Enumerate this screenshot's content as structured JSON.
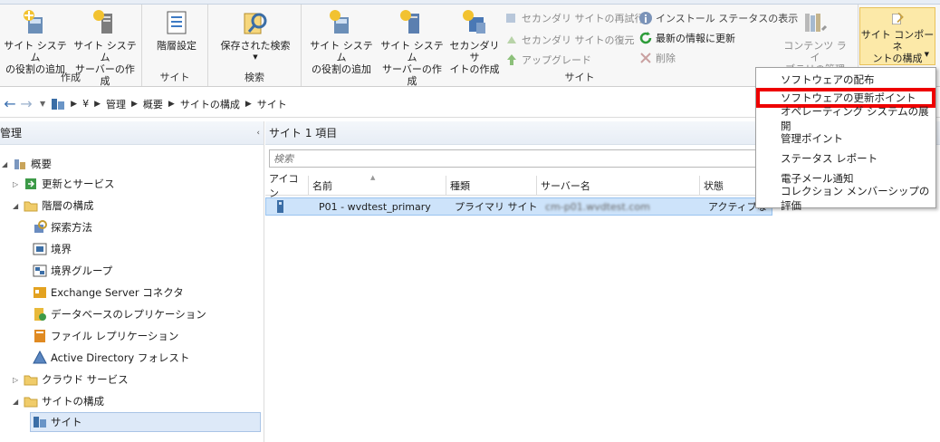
{
  "ribbon": {
    "create_group": {
      "label": "作成",
      "add_role": "サイト システム\nの役割の追加",
      "create_server": "サイト システム\nサーバーの作成"
    },
    "site_group": {
      "label": "サイト",
      "hierarchy_settings": "階層設定"
    },
    "search_group": {
      "label": "検索",
      "saved_search": "保存された検索"
    },
    "site2_group": {
      "label": "サイト",
      "add_role": "サイト システム\nの役割の追加",
      "create_server": "サイト システム\nサーバーの作成",
      "create_secondary": "セカンダリ サ\nイトの作成",
      "retry_secondary": "セカンダリ サイトの再試行",
      "recover_secondary": "セカンダリ サイトの復元",
      "upgrade": "アップグレード",
      "install_status": "インストール ステータスの表示",
      "refresh": "最新の情報に更新",
      "delete": "削除",
      "content_library": "コンテンツ ライ\nブラリの管理",
      "configure_components": "サイト コンポーネ\nントの構成"
    }
  },
  "addressbar": {
    "crumbs": [
      "¥",
      "管理",
      "概要",
      "サイトの構成",
      "サイト"
    ]
  },
  "tree": {
    "header": "管理",
    "items": [
      {
        "label": "概要"
      },
      {
        "label": "更新とサービス"
      },
      {
        "label": "階層の構成"
      },
      {
        "label": "探索方法"
      },
      {
        "label": "境界"
      },
      {
        "label": "境界グループ"
      },
      {
        "label": "Exchange Server コネクタ"
      },
      {
        "label": "データベースのレプリケーション"
      },
      {
        "label": "ファイル レプリケーション"
      },
      {
        "label": "Active Directory フォレスト"
      },
      {
        "label": "クラウド サービス"
      },
      {
        "label": "サイトの構成"
      },
      {
        "label": "サイト"
      }
    ]
  },
  "list": {
    "title": "サイト 1 項目",
    "search_placeholder": "検索",
    "columns": [
      "アイコン",
      "名前",
      "種類",
      "サーバー名",
      "状態"
    ],
    "rows": [
      {
        "name": "P01 - wvdtest_primary",
        "type": "プライマリ サイト",
        "server": "cm-p01.wvdtest.com",
        "status": "アクティブな"
      }
    ]
  },
  "menu": {
    "items": [
      "ソフトウェアの配布",
      "ソフトウェアの更新ポイント",
      "オペレーティング システムの展開",
      "管理ポイント",
      "ステータス レポート",
      "電子メール通知",
      "コレクション メンバーシップの評価"
    ],
    "highlighted_index": 1,
    "highlight_color": "#ee0000"
  }
}
